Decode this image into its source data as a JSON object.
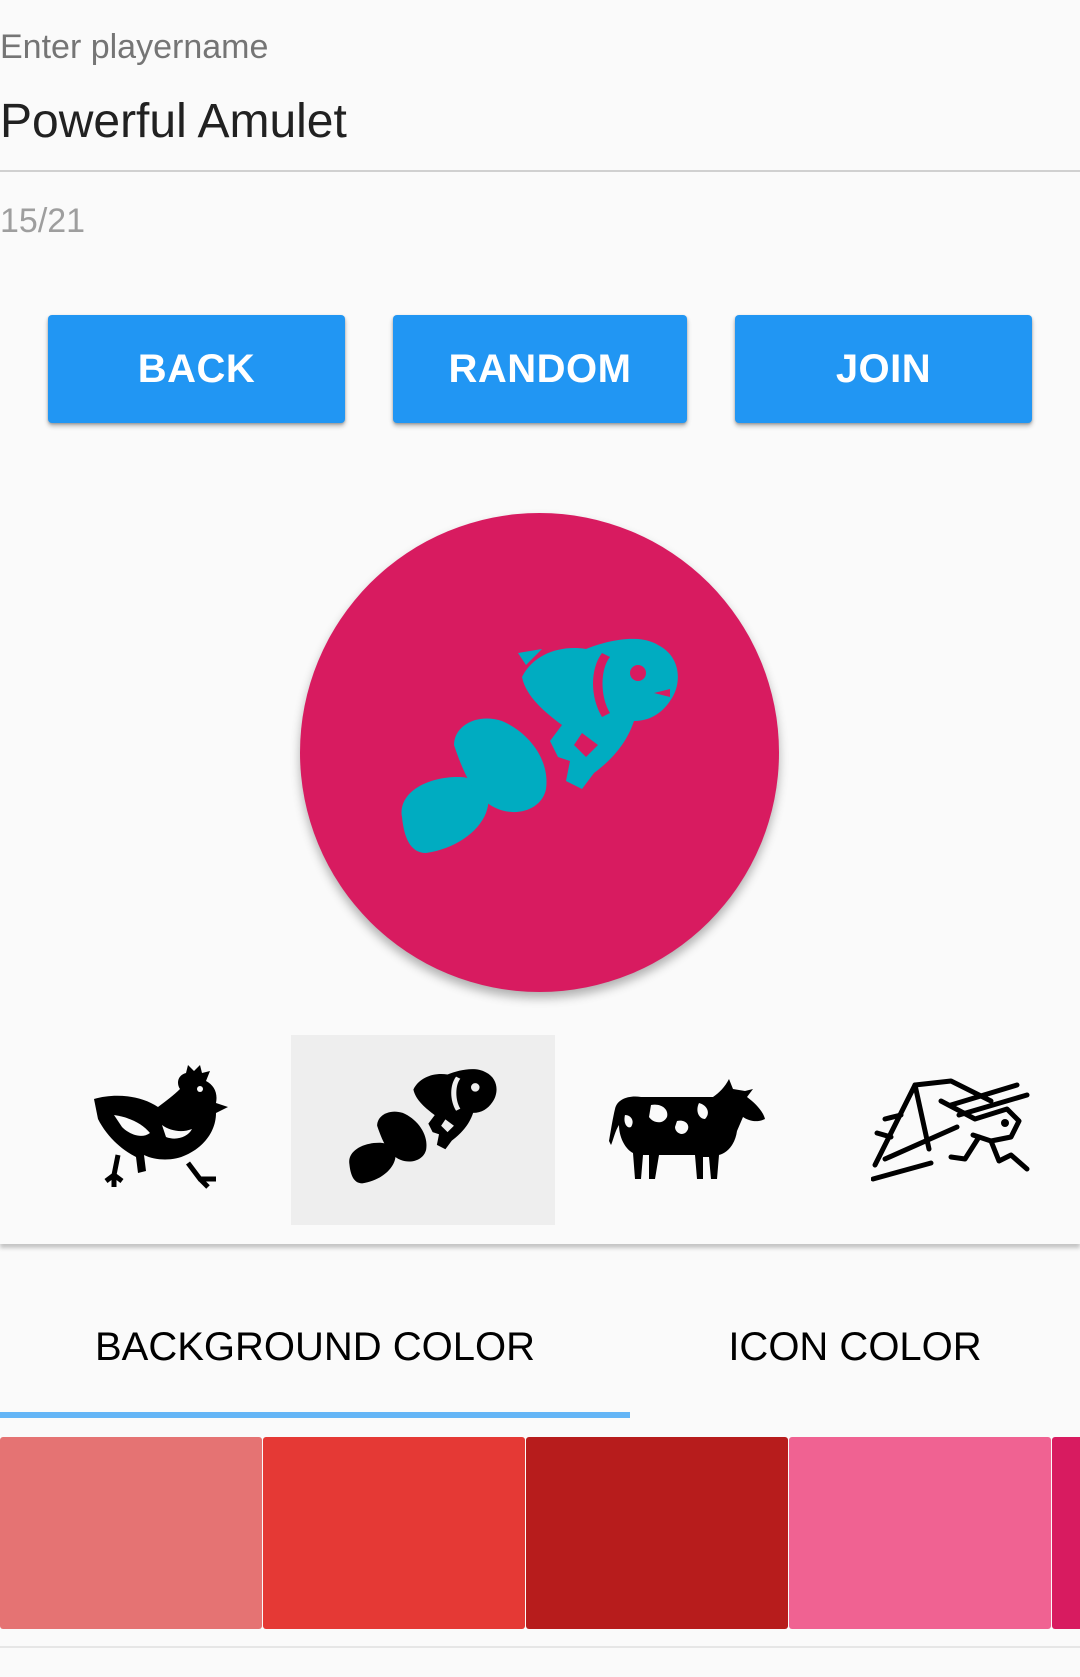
{
  "player_field": {
    "label": "Enter playername",
    "value": "Powerful Amulet",
    "counter": "15/21"
  },
  "buttons": {
    "back": "BACK",
    "random": "RANDOM",
    "join": "JOIN"
  },
  "avatar": {
    "background_color": "#d81b60",
    "icon_color": "#00acc1",
    "icon": "clownfish-icon"
  },
  "icon_picker": {
    "icons": [
      "rooster-icon",
      "clownfish-icon",
      "cow-icon",
      "grasshopper-icon"
    ],
    "selected": "clownfish-icon"
  },
  "tabs": {
    "background_color": "BACKGROUND COLOR",
    "icon_color": "ICON COLOR",
    "active": "BACKGROUND COLOR"
  },
  "colors": [
    "#e57373",
    "#e53935",
    "#b71c1c",
    "#f06292",
    "#d81b60"
  ],
  "theme": {
    "accent": "#2196f3",
    "tab_indicator": "#64b5f6"
  }
}
